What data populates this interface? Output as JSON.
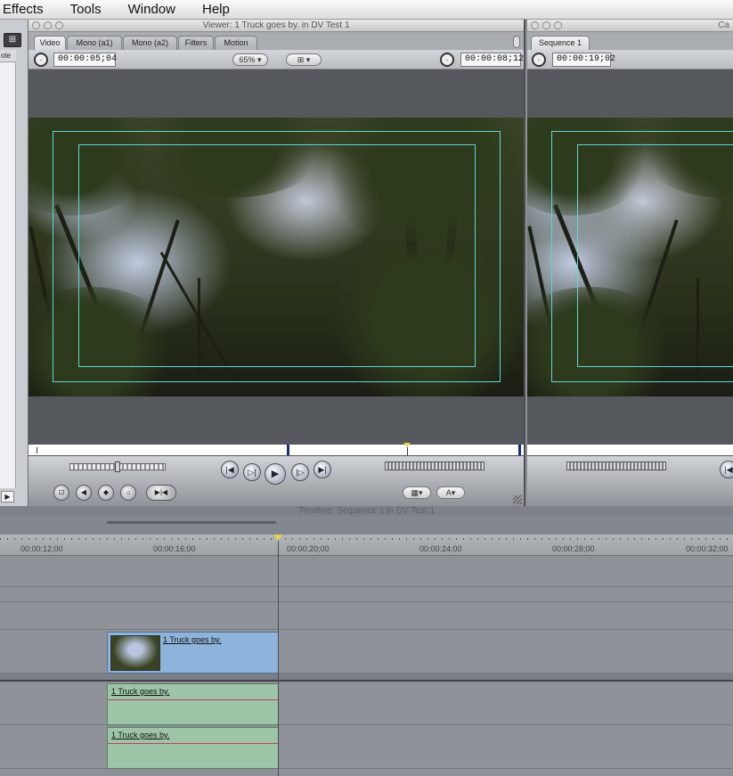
{
  "menubar": {
    "items": [
      {
        "label": "Effects"
      },
      {
        "label": "Tools"
      },
      {
        "label": "Window"
      },
      {
        "label": "Help"
      }
    ]
  },
  "browser": {
    "column_label": "ote"
  },
  "viewer": {
    "title": "Viewer: 1 Truck goes by. in DV Test 1",
    "tabs": [
      "Video",
      "Mono (a1)",
      "Mono (a2)",
      "Filters",
      "Motion"
    ],
    "active_tab": "Video",
    "duration_tc": "00:00:05;04",
    "zoom": "65%",
    "current_tc": "00:00:08;12",
    "scrubber_position": 0.764
  },
  "canvas": {
    "title": "Ca",
    "tab": "Sequence 1",
    "duration_tc": "00:00:19;02"
  },
  "timeline": {
    "title": "Timeline: Sequence 1 in DV Test 1",
    "ruler_labels": [
      "00:00:12;00",
      "00:00:16;00",
      "00:00:20;00",
      "00:00:24;00",
      "00:00:28;00",
      "00:00:32;00"
    ],
    "clips": {
      "video": "1 Truck goes by.",
      "audio1": "1 Truck goes by.",
      "audio2": "1 Truck goes by."
    }
  },
  "colors": {
    "clip_video": "#8eb4db",
    "clip_audio": "#9dc5a8",
    "safe_area": "#5fd7d7"
  }
}
